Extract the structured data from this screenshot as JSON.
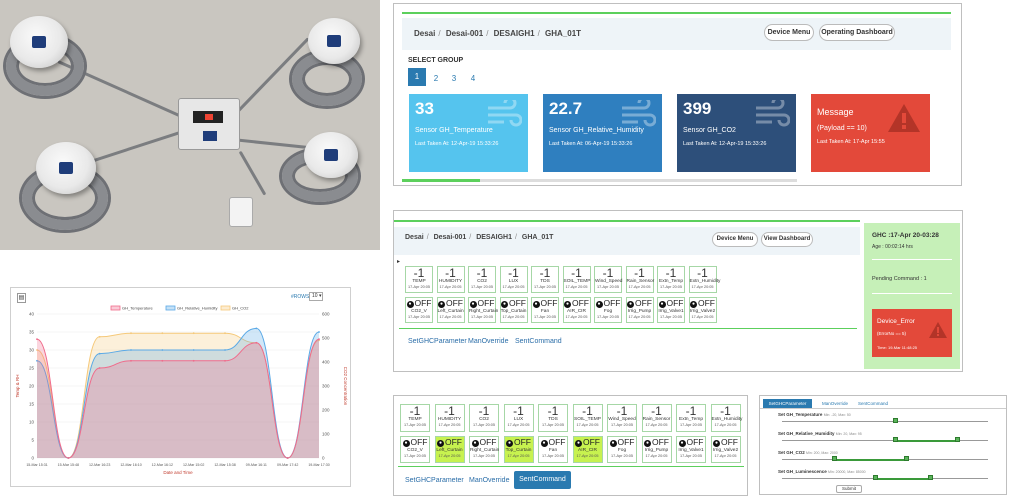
{
  "dashboard_top": {
    "breadcrumb": [
      "Desai",
      "Desai-001",
      "DESAIGH1",
      "GHA_01T"
    ],
    "device_menu": "Device Menu",
    "operating_dashboard": "Operating Dashboard",
    "select_group": "SELECT GROUP",
    "groups": [
      "1",
      "2",
      "3",
      "4"
    ],
    "cards": [
      {
        "value": "33",
        "name": "Sensor GH_Temperature",
        "taken": "Last Taken At: 12-Apr-19 15:33:26",
        "color": "#55c4ee"
      },
      {
        "value": "22.7",
        "name": "Sensor GH_Relative_Humidity",
        "taken": "Last Taken At: 06-Apr-19 15:33:26",
        "color": "#2f7fbf"
      },
      {
        "value": "399",
        "name": "Sensor GH_CO2",
        "taken": "Last Taken At: 12-Apr-19 15:33:26",
        "color": "#2d4f7a"
      },
      {
        "value": "Message",
        "name": "(Payload == 10)",
        "taken": "Last Taken At: 17-Apr 15:55",
        "color": "#e3493a"
      }
    ]
  },
  "dashboard_mid": {
    "breadcrumb": [
      "Desai",
      "Desai-001",
      "DESAIGH1",
      "GHA_01T"
    ],
    "device_menu": "Device Menu",
    "view_dashboard": "View Dashboard",
    "ghc_status": "GHC :17-Apr 20-03:28",
    "age": "Age : 00:02:14 hrs",
    "pending": "Pending Command : 1",
    "error_title": "Device_Error",
    "error_cond": "(ErrorNo == 5)",
    "error_time": "Time: 19-Mar 11:48:25",
    "links": [
      "SetGHCParameter",
      "ManOverride",
      "SentCommand"
    ]
  },
  "dashboard_bottom": {
    "links": [
      "SetGHCParameter",
      "ManOverride",
      "SentCommand"
    ]
  },
  "sensors": [
    {
      "label": "TEMP",
      "value": "-1",
      "time": "17-Apr 20:05"
    },
    {
      "label": "HUMIDITY",
      "value": "-1",
      "time": "17-Apr 20:05"
    },
    {
      "label": "CO2",
      "value": "-1",
      "time": "17-Apr 20:05"
    },
    {
      "label": "LUX",
      "value": "-1",
      "time": "17-Apr 20:05"
    },
    {
      "label": "TDS",
      "value": "-1",
      "time": "17-Apr 20:05"
    },
    {
      "label": "SOIL_TEMP",
      "value": "-1",
      "time": "17-Apr 20:05"
    },
    {
      "label": "Wind_Speed",
      "value": "-1",
      "time": "17-Apr 20:05"
    },
    {
      "label": "Rain_Sensor",
      "value": "-1",
      "time": "17-Apr 20:05"
    },
    {
      "label": "Extn_Temp",
      "value": "-1",
      "time": "17-Apr 20:05"
    },
    {
      "label": "Extn_Humidity",
      "value": "-1",
      "time": "17-Apr 20:05"
    }
  ],
  "switches_mid": [
    {
      "label": "CO2_V",
      "state": "OFF",
      "time": "17-Apr 20:05"
    },
    {
      "label": "Left_Curtain",
      "state": "OFF",
      "time": "17-Apr 20:05"
    },
    {
      "label": "Right_Curtain",
      "state": "OFF",
      "time": "17-Apr 20:05"
    },
    {
      "label": "Top_Curtain",
      "state": "OFF",
      "time": "17-Apr 20:05"
    },
    {
      "label": "Fan",
      "state": "OFF",
      "time": "17-Apr 20:05"
    },
    {
      "label": "AIR_CIR",
      "state": "OFF",
      "time": "17-Apr 20:05"
    },
    {
      "label": "Fog",
      "state": "OFF",
      "time": "17-Apr 20:05"
    },
    {
      "label": "Irrig_Pump",
      "state": "OFF",
      "time": "17-Apr 20:05"
    },
    {
      "label": "Irrig_Valve1",
      "state": "OFF",
      "time": "17-Apr 20:05"
    },
    {
      "label": "Irrig_Valve2",
      "state": "OFF",
      "time": "17-Apr 20:05"
    }
  ],
  "switches_bottom_highlight": [
    false,
    true,
    false,
    true,
    false,
    true,
    false,
    false,
    false,
    false
  ],
  "chart": {
    "legend": [
      "GH_Temperature",
      "GH_Relative_Humidity",
      "GH_CO2"
    ],
    "rows_label": "#ROWS",
    "rows_value": "10",
    "xlabel": "Date and Time",
    "ylabel_left": "Temp & RH",
    "ylabel_right": "CO2 Concentration",
    "colors": [
      "#f06b8b",
      "#5aa9e6",
      "#f5c97a"
    ]
  },
  "chart_data": {
    "type": "area",
    "categories": [
      "15-Mar 15:31",
      "15-Mar 15:48",
      "12-Mar 16:23",
      "12-Mar 16:10",
      "12-Mar 16:12",
      "12-Mar 15:02",
      "12-Mar 15:38",
      "09-Mar 16:11",
      "09-Mar 17:42",
      "19-Mar 17:30"
    ],
    "yleft_ticks": [
      "0",
      "5",
      "10",
      "15",
      "20",
      "25",
      "30",
      "35",
      "40"
    ],
    "yright_ticks": [
      "0",
      "100",
      "200",
      "300",
      "400",
      "500",
      "600"
    ],
    "ylim_left": [
      0,
      40
    ],
    "ylim_right": [
      0,
      600
    ],
    "series": [
      {
        "name": "GH_Temperature",
        "axis": "left",
        "values": [
          33,
          0,
          25,
          27,
          27,
          27,
          27,
          32,
          0,
          33
        ]
      },
      {
        "name": "GH_Relative_Humidity",
        "axis": "left",
        "values": [
          27,
          0,
          29,
          30,
          30,
          30,
          30,
          36,
          0,
          35
        ]
      },
      {
        "name": "GH_CO2",
        "axis": "right",
        "values": [
          450,
          0,
          505,
          520,
          520,
          520,
          520,
          480,
          0,
          490
        ]
      }
    ]
  },
  "settings": {
    "tabs": [
      "SetGHCParameter",
      "ManOverride",
      "SentCommand"
    ],
    "rows": [
      {
        "label": "Set GH_Temperature",
        "range": "Min: -20, Max: 50"
      },
      {
        "label": "Set GH_Relative_Humidity",
        "range": "Min: 20, Max: 95"
      },
      {
        "label": "Set GH_CO2",
        "range": "Min: 200, Max: 2000"
      },
      {
        "label": "Set GH_Luminescence",
        "range": "Min: 20000, Max: 85000"
      }
    ],
    "submit": "Submit"
  }
}
